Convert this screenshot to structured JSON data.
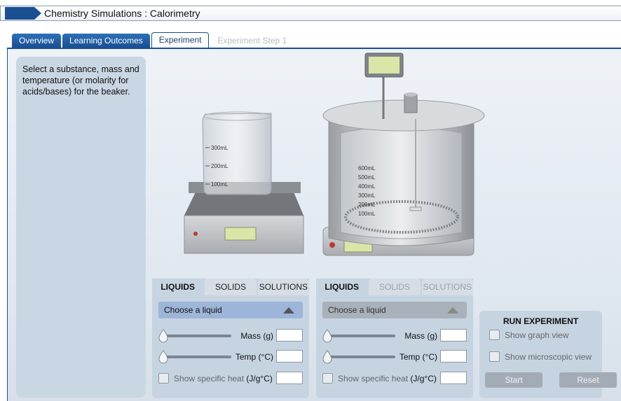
{
  "window": {
    "title": "Chemistry Simulations : Calorimetry"
  },
  "tabs": [
    {
      "label": "Overview"
    },
    {
      "label": "Learning Outcomes"
    },
    {
      "label": "Experiment"
    },
    {
      "label": "Experiment Step 1"
    }
  ],
  "instructions": "Select a substance, mass and temperature (or molarity for acids/bases) for the beaker.",
  "beaker": {
    "marks": [
      "300mL",
      "200mL",
      "100mL"
    ]
  },
  "calorimeter": {
    "marks": [
      "600mL",
      "500mL",
      "400mL",
      "300mL",
      "200mL",
      "100mL"
    ]
  },
  "panel_left": {
    "tabs": [
      "LIQUIDS",
      "SOLIDS",
      "SOLUTIONS"
    ],
    "dropdown": "Choose a liquid",
    "mass_label": "Mass (g)",
    "temp_label": "Temp (°C)",
    "specific_heat_label": "Show specific heat",
    "specific_heat_unit": "(J/g°C)"
  },
  "panel_right": {
    "tabs": [
      "LIQUIDS",
      "SOLIDS",
      "SOLUTIONS"
    ],
    "dropdown": "Choose a liquid",
    "mass_label": "Mass (g)",
    "temp_label": "Temp (°C)",
    "specific_heat_label": "Show specific heat",
    "specific_heat_unit": "(J/g°C)"
  },
  "run": {
    "title": "RUN EXPERIMENT",
    "graph_label": "Show graph view",
    "micro_label": "Show microscopic view",
    "start_label": "Start",
    "reset_label": "Reset"
  },
  "colors": {
    "accent": "#1a4f92",
    "panel": "#c6d4e2",
    "dropdown_active": "#9db5d8"
  }
}
